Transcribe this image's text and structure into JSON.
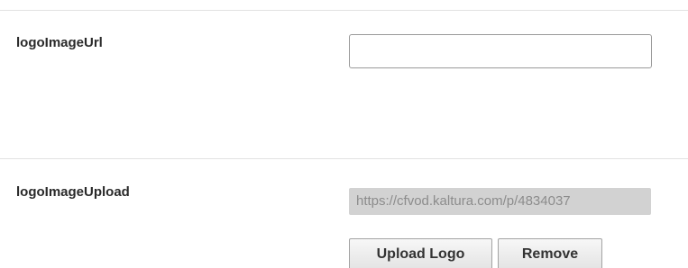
{
  "fields": {
    "logo_url": {
      "label": "logoImageUrl",
      "value": ""
    },
    "logo_upload": {
      "label": "logoImageUpload",
      "value": "https://cfvod.kaltura.com/p/4834037"
    }
  },
  "buttons": {
    "upload_label": "Upload Logo",
    "remove_label": "Remove"
  }
}
